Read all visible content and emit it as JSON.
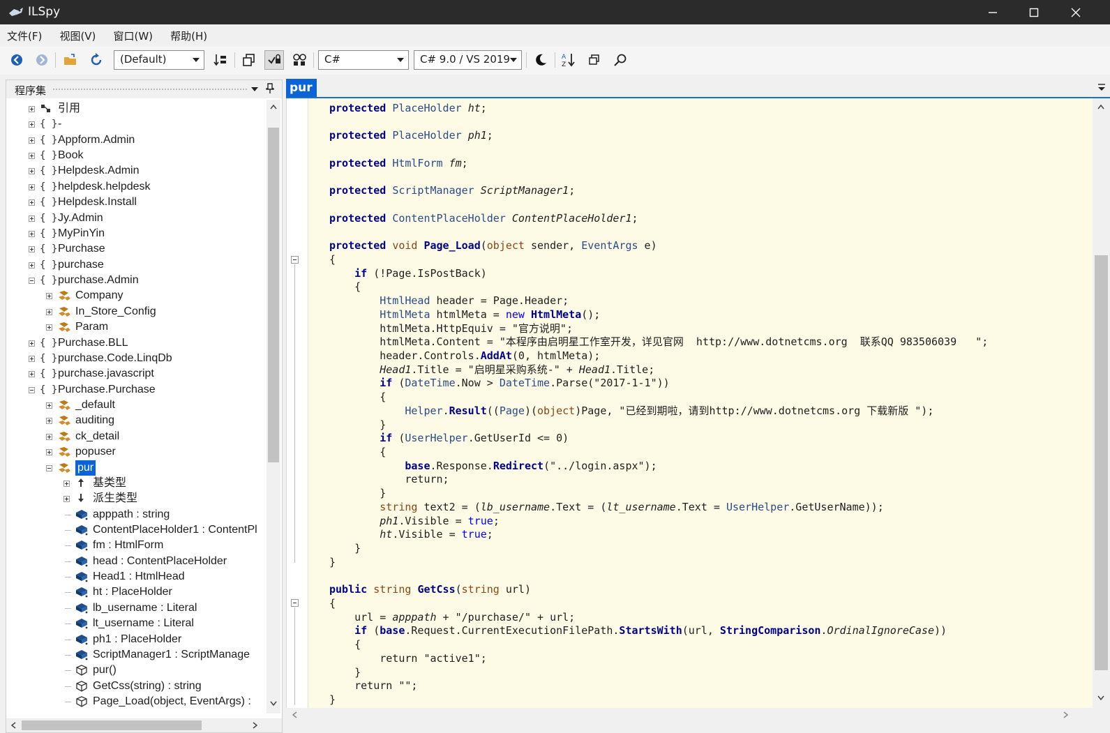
{
  "window": {
    "title": "ILSpy",
    "minimize": "—",
    "maximize": "☐",
    "close": "✕"
  },
  "menu": [
    "文件(F)",
    "视图(V)",
    "窗口(W)",
    "帮助(H)"
  ],
  "toolbar": {
    "assembly_list": "(Default)",
    "language": "C#",
    "language_version": "C# 9.0 / VS 2019"
  },
  "assemblies_panel": {
    "title": "程序集",
    "tree": [
      {
        "label": "引用",
        "kind": "refs",
        "depth": 0,
        "expanded": false
      },
      {
        "label": "-",
        "kind": "ns",
        "depth": 0,
        "expanded": false
      },
      {
        "label": "Appform.Admin",
        "kind": "ns",
        "depth": 0,
        "expanded": false
      },
      {
        "label": "Book",
        "kind": "ns",
        "depth": 0,
        "expanded": false
      },
      {
        "label": "Helpdesk.Admin",
        "kind": "ns",
        "depth": 0,
        "expanded": false
      },
      {
        "label": "helpdesk.helpdesk",
        "kind": "ns",
        "depth": 0,
        "expanded": false
      },
      {
        "label": "Helpdesk.Install",
        "kind": "ns",
        "depth": 0,
        "expanded": false
      },
      {
        "label": "Jy.Admin",
        "kind": "ns",
        "depth": 0,
        "expanded": false
      },
      {
        "label": "MyPinYin",
        "kind": "ns",
        "depth": 0,
        "expanded": false
      },
      {
        "label": "Purchase",
        "kind": "ns",
        "depth": 0,
        "expanded": false
      },
      {
        "label": "purchase",
        "kind": "ns",
        "depth": 0,
        "expanded": false
      },
      {
        "label": "purchase.Admin",
        "kind": "ns",
        "depth": 0,
        "expanded": true
      },
      {
        "label": "Company",
        "kind": "class",
        "depth": 1,
        "expanded": false
      },
      {
        "label": "In_Store_Config",
        "kind": "class",
        "depth": 1,
        "expanded": false
      },
      {
        "label": "Param",
        "kind": "class",
        "depth": 1,
        "expanded": false
      },
      {
        "label": "Purchase.BLL",
        "kind": "ns",
        "depth": 0,
        "expanded": false
      },
      {
        "label": "purchase.Code.LinqDb",
        "kind": "ns",
        "depth": 0,
        "expanded": false
      },
      {
        "label": "purchase.javascript",
        "kind": "ns",
        "depth": 0,
        "expanded": false
      },
      {
        "label": "Purchase.Purchase",
        "kind": "ns",
        "depth": 0,
        "expanded": true
      },
      {
        "label": "_default",
        "kind": "class",
        "depth": 1,
        "expanded": false
      },
      {
        "label": "auditing",
        "kind": "class",
        "depth": 1,
        "expanded": false
      },
      {
        "label": "ck_detail",
        "kind": "class",
        "depth": 1,
        "expanded": false
      },
      {
        "label": "popuser",
        "kind": "class",
        "depth": 1,
        "expanded": false
      },
      {
        "label": "pur",
        "kind": "class",
        "depth": 1,
        "expanded": true,
        "selected": true
      },
      {
        "label": "基类型",
        "kind": "base",
        "depth": 2,
        "expanded": false
      },
      {
        "label": "派生类型",
        "kind": "derived",
        "depth": 2,
        "expanded": false
      },
      {
        "label": "apppath : string",
        "kind": "field",
        "depth": 2
      },
      {
        "label": "ContentPlaceHolder1 : ContentPl",
        "kind": "field",
        "depth": 2
      },
      {
        "label": "fm : HtmlForm",
        "kind": "field",
        "depth": 2
      },
      {
        "label": "head : ContentPlaceHolder",
        "kind": "field",
        "depth": 2
      },
      {
        "label": "Head1 : HtmlHead",
        "kind": "field",
        "depth": 2
      },
      {
        "label": "ht : PlaceHolder",
        "kind": "field",
        "depth": 2
      },
      {
        "label": "lb_username : Literal",
        "kind": "field",
        "depth": 2
      },
      {
        "label": "lt_username : Literal",
        "kind": "field",
        "depth": 2
      },
      {
        "label": "ph1 : PlaceHolder",
        "kind": "field",
        "depth": 2
      },
      {
        "label": "ScriptManager1 : ScriptManage",
        "kind": "field",
        "depth": 2
      },
      {
        "label": "pur()",
        "kind": "method",
        "depth": 2
      },
      {
        "label": "GetCss(string) : string",
        "kind": "method",
        "depth": 2
      },
      {
        "label": "Page_Load(object, EventArgs) :",
        "kind": "method",
        "depth": 2
      }
    ]
  },
  "editor": {
    "tab": "pur",
    "lines": [
      [
        [
          "kw",
          "protected "
        ],
        [
          "ty",
          "PlaceHolder "
        ],
        [
          "it",
          "ht"
        ],
        [
          "",
          "; "
        ]
      ],
      [],
      [
        [
          "kw",
          "protected "
        ],
        [
          "ty",
          "PlaceHolder "
        ],
        [
          "it",
          "ph1"
        ],
        [
          "",
          ";"
        ]
      ],
      [],
      [
        [
          "kw",
          "protected "
        ],
        [
          "ty",
          "HtmlForm "
        ],
        [
          "it",
          "fm"
        ],
        [
          "",
          ";"
        ]
      ],
      [],
      [
        [
          "kw",
          "protected "
        ],
        [
          "ty",
          "ScriptManager "
        ],
        [
          "it",
          "ScriptManager1"
        ],
        [
          "",
          ";"
        ]
      ],
      [],
      [
        [
          "kw",
          "protected "
        ],
        [
          "ty",
          "ContentPlaceHolder "
        ],
        [
          "it",
          "ContentPlaceHolder1"
        ],
        [
          "",
          ";"
        ]
      ],
      [],
      [
        [
          "kw",
          "protected "
        ],
        [
          "pt",
          "void "
        ],
        [
          "kw",
          "Page_Load"
        ],
        [
          "",
          "("
        ],
        [
          "pt",
          "object"
        ],
        [
          "",
          " sender, "
        ],
        [
          "ty",
          "EventArgs"
        ],
        [
          "",
          " e)"
        ]
      ],
      [
        [
          "",
          "{"
        ]
      ],
      [
        [
          "",
          "    "
        ],
        [
          "kw",
          "if"
        ],
        [
          "",
          " (!Page.IsPostBack)"
        ]
      ],
      [
        [
          "",
          "    {"
        ]
      ],
      [
        [
          "",
          "        "
        ],
        [
          "ty",
          "HtmlHead"
        ],
        [
          "",
          " header = Page.Header;"
        ]
      ],
      [
        [
          "",
          "        "
        ],
        [
          "ty",
          "HtmlMeta"
        ],
        [
          "",
          " htmlMeta = "
        ],
        [
          "kv",
          "new "
        ],
        [
          "kw",
          "HtmlMeta"
        ],
        [
          "",
          "();"
        ]
      ],
      [
        [
          "",
          "        htmlMeta.HttpEquiv = \"官方说明\";"
        ]
      ],
      [
        [
          "",
          "        htmlMeta.Content = \"本程序由启明星工作室开发，详见官网  http://www.dotnetcms.org  联系QQ 983506039   \";"
        ]
      ],
      [
        [
          "",
          "        header.Controls."
        ],
        [
          "kw",
          "AddAt"
        ],
        [
          "",
          "(0, htmlMeta);"
        ]
      ],
      [
        [
          "",
          "        "
        ],
        [
          "it",
          "Head1"
        ],
        [
          "",
          ".Title = \"启明星采购系统-\" + "
        ],
        [
          "it",
          "Head1"
        ],
        [
          "",
          ".Title;"
        ]
      ],
      [
        [
          "",
          "        "
        ],
        [
          "kw",
          "if"
        ],
        [
          "",
          " ("
        ],
        [
          "ty",
          "DateTime"
        ],
        [
          "",
          ".Now > "
        ],
        [
          "ty",
          "DateTime"
        ],
        [
          "",
          ".Parse(\"2017-1-1\"))"
        ]
      ],
      [
        [
          "",
          "        {"
        ]
      ],
      [
        [
          "",
          "            "
        ],
        [
          "ty",
          "Helper"
        ],
        [
          "",
          "."
        ],
        [
          "kw",
          "Result"
        ],
        [
          "",
          "(("
        ],
        [
          "ty",
          "Page"
        ],
        [
          "",
          ")("
        ],
        [
          "pt",
          "object"
        ],
        [
          "",
          ")Page, \"已经到期啦，请到http://www.dotnetcms.org 下载新版 \");"
        ]
      ],
      [
        [
          "",
          "        }"
        ]
      ],
      [
        [
          "",
          "        "
        ],
        [
          "kw",
          "if"
        ],
        [
          "",
          " ("
        ],
        [
          "ty",
          "UserHelper"
        ],
        [
          "",
          ".GetUserId <= 0)"
        ]
      ],
      [
        [
          "",
          "        {"
        ]
      ],
      [
        [
          "",
          "            "
        ],
        [
          "kw",
          "base"
        ],
        [
          "",
          ".Response."
        ],
        [
          "kw",
          "Redirect"
        ],
        [
          "",
          "(\"../login.aspx\");"
        ]
      ],
      [
        [
          "",
          "            return;"
        ]
      ],
      [
        [
          "",
          "        }"
        ]
      ],
      [
        [
          "",
          "        "
        ],
        [
          "pt",
          "string"
        ],
        [
          "",
          " text2 = ("
        ],
        [
          "it",
          "lb_username"
        ],
        [
          "",
          ".Text = ("
        ],
        [
          "it",
          "lt_username"
        ],
        [
          "",
          ".Text = "
        ],
        [
          "ty",
          "UserHelper"
        ],
        [
          "",
          ".GetUserName));"
        ]
      ],
      [
        [
          "",
          "        "
        ],
        [
          "it",
          "ph1"
        ],
        [
          "",
          ".Visible = "
        ],
        [
          "kv",
          "true"
        ],
        [
          "",
          ";"
        ]
      ],
      [
        [
          "",
          "        "
        ],
        [
          "it",
          "ht"
        ],
        [
          "",
          ".Visible = "
        ],
        [
          "kv",
          "true"
        ],
        [
          "",
          ";"
        ]
      ],
      [
        [
          "",
          "    }"
        ]
      ],
      [
        [
          "",
          "}"
        ]
      ],
      [],
      [
        [
          "kw",
          "public "
        ],
        [
          "pt",
          "string "
        ],
        [
          "kw",
          "GetCss"
        ],
        [
          "",
          "("
        ],
        [
          "pt",
          "string"
        ],
        [
          "",
          " url)"
        ]
      ],
      [
        [
          "",
          "{"
        ]
      ],
      [
        [
          "",
          "    url = "
        ],
        [
          "it",
          "apppath"
        ],
        [
          "",
          " + \"/purchase/\" + url;"
        ]
      ],
      [
        [
          "",
          "    "
        ],
        [
          "kw",
          "if"
        ],
        [
          "",
          " ("
        ],
        [
          "kw",
          "base"
        ],
        [
          "",
          ".Request.CurrentExecutionFilePath."
        ],
        [
          "kw",
          "StartsWith"
        ],
        [
          "",
          "(url, "
        ],
        [
          "kw",
          "StringComparison"
        ],
        [
          "",
          "."
        ],
        [
          "it",
          "OrdinalIgnoreCase"
        ],
        [
          "",
          "))"
        ]
      ],
      [
        [
          "",
          "    {"
        ]
      ],
      [
        [
          "",
          "        return \"active1\";"
        ]
      ],
      [
        [
          "",
          "    }"
        ]
      ],
      [
        [
          "",
          "    return \"\";"
        ]
      ],
      [
        [
          "",
          "}"
        ]
      ]
    ]
  }
}
